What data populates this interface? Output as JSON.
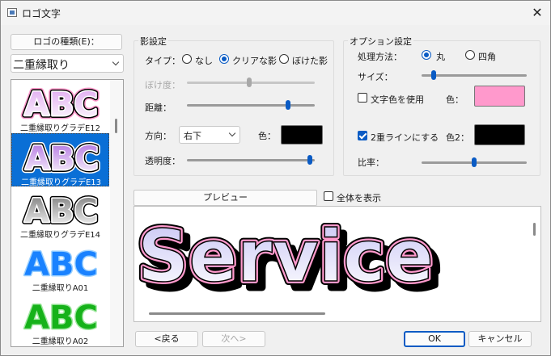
{
  "window": {
    "title": "ロゴ文字",
    "close": "✕"
  },
  "left": {
    "kind_label": "ロゴの種類(E)：",
    "kind_selected": "二重縁取り",
    "items": [
      {
        "text": "ABC",
        "caption": "二重縁取りグラデE12"
      },
      {
        "text": "ABC",
        "caption": "二重縁取りグラデE13"
      },
      {
        "text": "ABC",
        "caption": "二重縁取りグラデE14"
      },
      {
        "text": "ABC",
        "caption": "二重縁取りA01"
      },
      {
        "text": "ABC",
        "caption": "二重縁取りA02"
      }
    ]
  },
  "shadow": {
    "group_label": "影設定",
    "type_label": "タイプ：",
    "type_options": [
      "なし",
      "クリアな影",
      "ぼけた影"
    ],
    "type_selected": 1,
    "blur_label": "ぼけ度：",
    "blur_level": 0.49,
    "distance_label": "距離：",
    "distance_level": 0.8,
    "direction_label": "方向：",
    "direction_value": "右下",
    "color_label": "色：",
    "color_value": "#000000",
    "opacity_label": "透明度：",
    "opacity_level": 0.98
  },
  "options": {
    "group_label": "オプション設定",
    "method_label": "処理方法：",
    "method_options": [
      "丸",
      "四角"
    ],
    "method_selected": 0,
    "size_label": "サイズ：",
    "size_level": 0.1,
    "use_text_color_label": "文字色を使用",
    "use_text_color_checked": false,
    "color_label": "色：",
    "color_value": "#ff99cc",
    "double_line_label": "2重ラインにする",
    "double_line_checked": true,
    "color2_label": "色2：",
    "color2_value": "#000000",
    "ratio_label": "比率：",
    "ratio_level": 0.5
  },
  "preview": {
    "tab_label": "プレビュー",
    "show_all_label": "全体を表示",
    "show_all_checked": false,
    "text": "Service"
  },
  "buttons": {
    "back": "<戻る",
    "next": "次へ>",
    "ok": "OK",
    "cancel": "キャンセル"
  }
}
